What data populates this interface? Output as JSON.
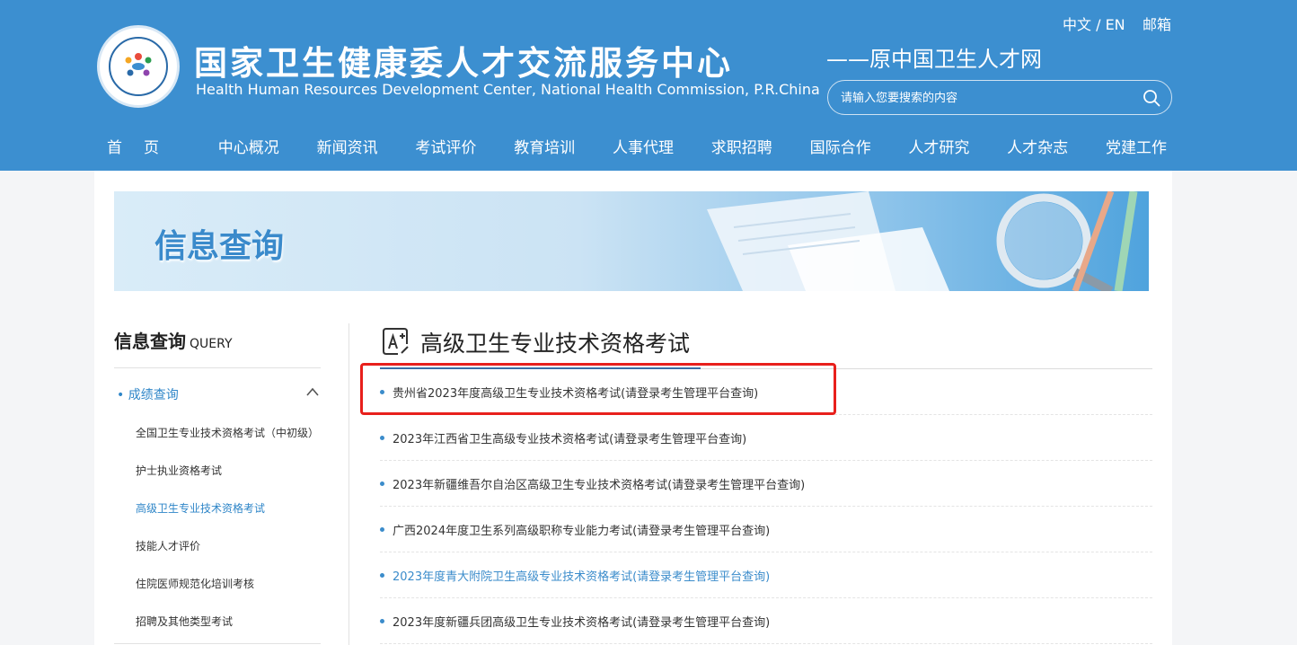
{
  "header": {
    "site_title": "国家卫生健康委人才交流服务中心",
    "site_subtitle": "Health Human Resources Development Center, National Health Commission, P.R.China",
    "former_name": "——原中国卫生人才网",
    "lang_switch": "中文 / EN",
    "mailbox": "邮箱",
    "search_placeholder": "请输入您要搜索的内容",
    "logo_ring_text": "国家卫生健康委人才交流服务中心"
  },
  "nav": {
    "items": [
      {
        "label": "首页"
      },
      {
        "label": "中心概况"
      },
      {
        "label": "新闻资讯"
      },
      {
        "label": "考试评价"
      },
      {
        "label": "教育培训"
      },
      {
        "label": "人事代理"
      },
      {
        "label": "求职招聘"
      },
      {
        "label": "国际合作"
      },
      {
        "label": "人才研究"
      },
      {
        "label": "人才杂志"
      },
      {
        "label": "党建工作"
      }
    ]
  },
  "banner": {
    "title": "信息查询"
  },
  "sidebar": {
    "heading": "信息查询",
    "heading_en": "QUERY",
    "active_group": "• 成绩查询",
    "items": [
      {
        "label": "全国卫生专业技术资格考试（中初级）"
      },
      {
        "label": "护士执业资格考试"
      },
      {
        "label": "高级卫生专业技术资格考试"
      },
      {
        "label": "技能人才评价"
      },
      {
        "label": "住院医师规范化培训考核"
      },
      {
        "label": "招聘及其他类型考试"
      }
    ]
  },
  "main": {
    "section_title": "高级卫生专业技术资格考试",
    "items": [
      {
        "text": "贵州省2023年度高级卫生专业技术资格考试(请登录考生管理平台查询)"
      },
      {
        "text": "2023年江西省卫生高级专业技术资格考试(请登录考生管理平台查询)"
      },
      {
        "text": "2023年新疆维吾尔自治区高级卫生专业技术资格考试(请登录考生管理平台查询)"
      },
      {
        "text": "广西2024年度卫生系列高级职称专业能力考试(请登录考生管理平台查询)"
      },
      {
        "text": "2023年度青大附院卫生高级专业技术资格考试(请登录考生管理平台查询)"
      },
      {
        "text": "2023年度新疆兵团高级卫生专业技术资格考试(请登录考生管理平台查询)"
      }
    ]
  },
  "colors": {
    "header_blue": "#3c8fd0",
    "accent_blue": "#2f86c8",
    "highlight_red": "#e8201c"
  }
}
